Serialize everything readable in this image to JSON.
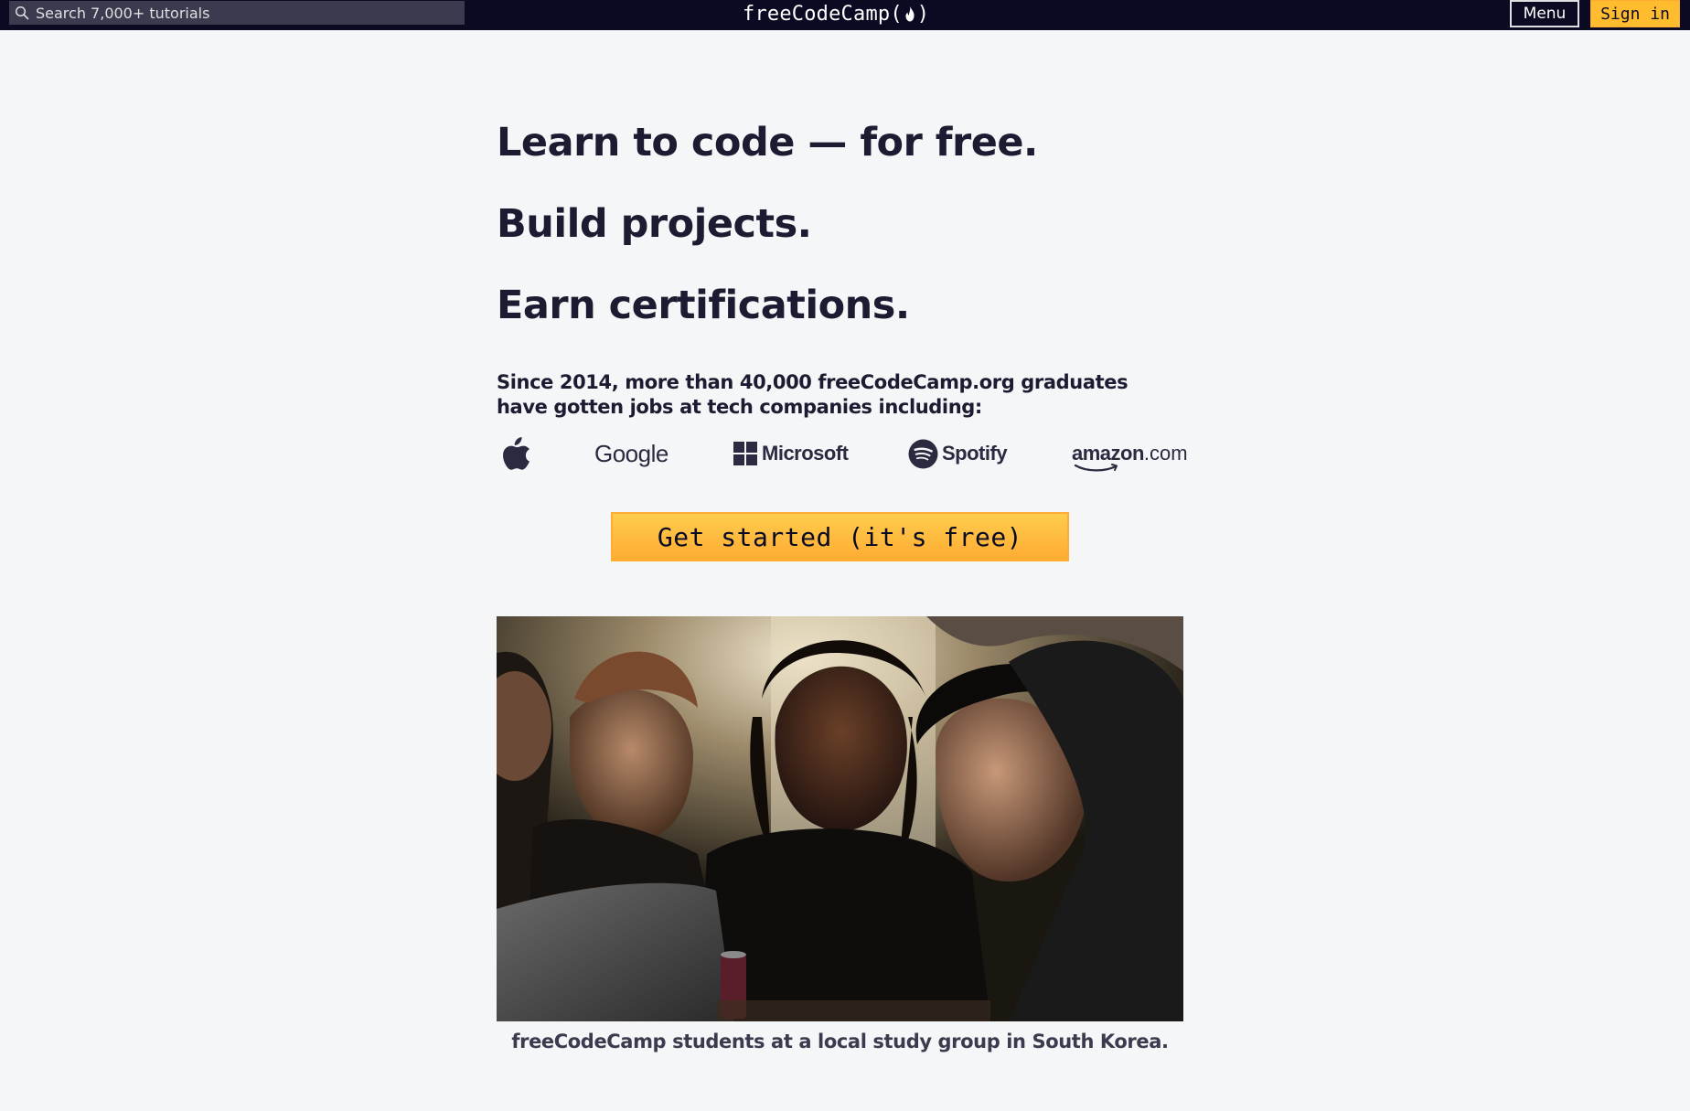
{
  "nav": {
    "search_placeholder": "Search 7,000+ tutorials",
    "logo_text": "freeCodeCamp",
    "logo_open": "(",
    "logo_close": ")",
    "menu_label": "Menu",
    "signin_label": "Sign in"
  },
  "hero": {
    "line1": "Learn to code — for free.",
    "line2": "Build projects.",
    "line3": "Earn certifications.",
    "intro": "Since 2014, more than 40,000 freeCodeCamp.org graduates have gotten jobs at tech companies including:",
    "cta_label": "Get started (it's free)",
    "caption": "freeCodeCamp students at a local study group in South Korea."
  },
  "companies": {
    "apple": "apple-logo",
    "google": "Google",
    "microsoft": "Microsoft",
    "spotify": "Spotify",
    "amazon_main": "amazon",
    "amazon_tld": ".com"
  },
  "colors": {
    "nav_bg": "#0a0a23",
    "page_bg": "#f5f6f7",
    "accent": "#febc2e",
    "text": "#1b1b32"
  }
}
